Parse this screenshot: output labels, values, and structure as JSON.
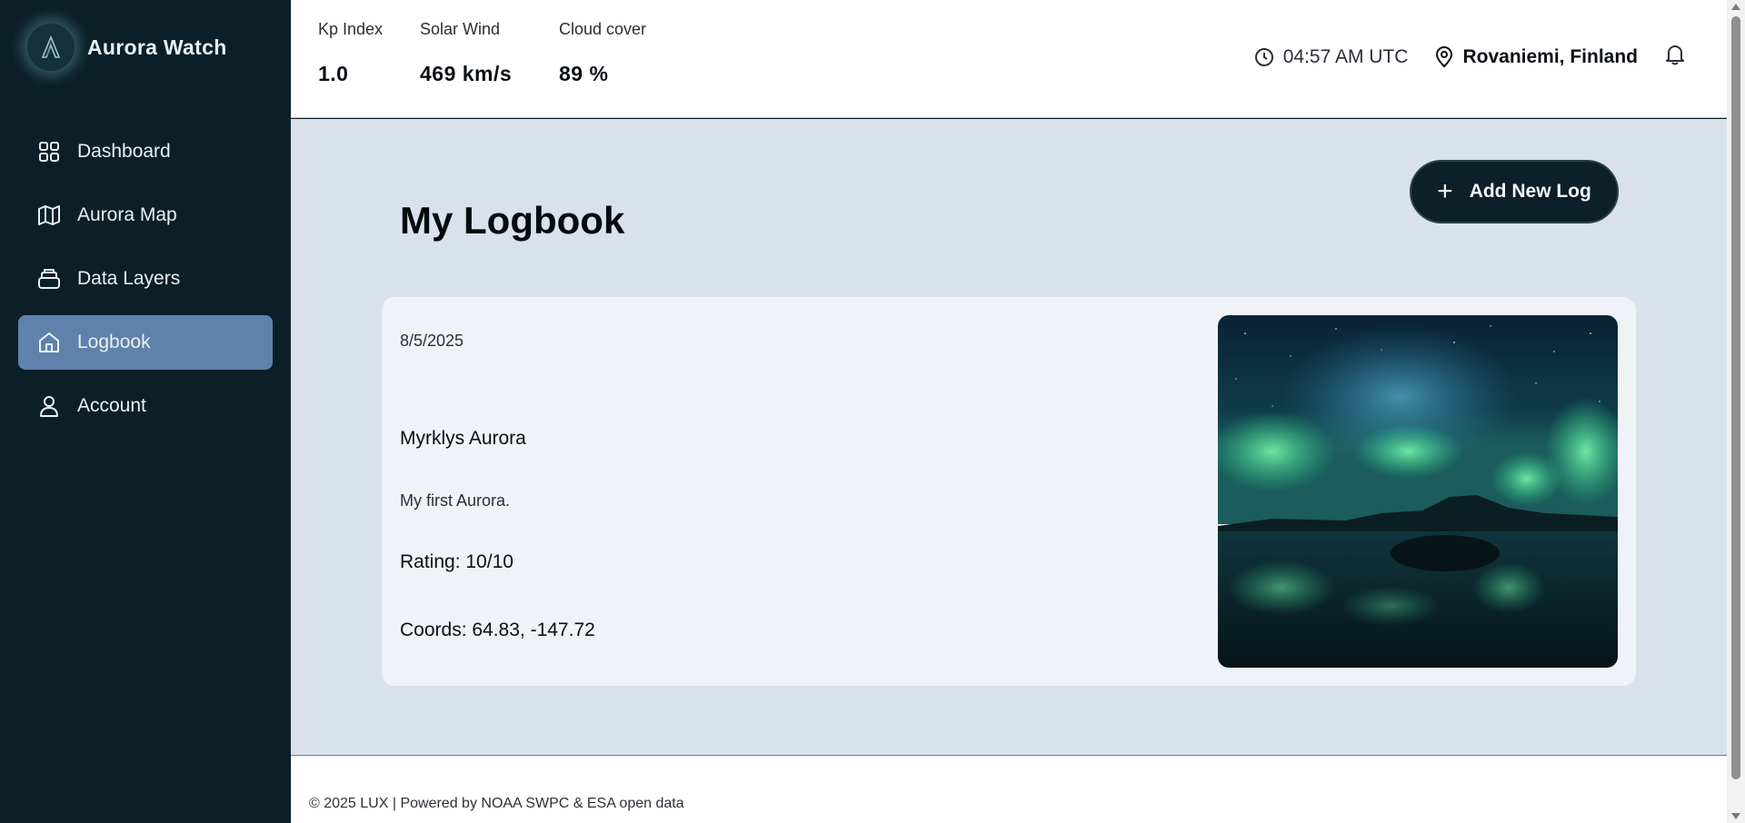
{
  "app": {
    "name": "Aurora Watch"
  },
  "sidebar": {
    "items": [
      {
        "label": "Dashboard",
        "icon": "grid-icon"
      },
      {
        "label": "Aurora Map",
        "icon": "map-icon"
      },
      {
        "label": "Data Layers",
        "icon": "layers-icon"
      },
      {
        "label": "Logbook",
        "icon": "home-icon",
        "active": true
      },
      {
        "label": "Account",
        "icon": "user-icon"
      }
    ]
  },
  "topbar": {
    "stats": [
      {
        "label": "Kp Index",
        "value": "1.0"
      },
      {
        "label": "Solar Wind",
        "value": "469 km/s"
      },
      {
        "label": "Cloud cover",
        "value": "89 %"
      }
    ],
    "time": "04:57 AM UTC",
    "location": "Rovaniemi, Finland"
  },
  "main": {
    "title": "My Logbook",
    "add_button": "Add New Log",
    "entry": {
      "date": "8/5/2025",
      "title": "Myrklys Aurora",
      "description": "My first Aurora.",
      "rating": "Rating: 10/10",
      "coords": "Coords: 64.83, -147.72"
    }
  },
  "footer": {
    "text": "© 2025 LUX | Powered by NOAA SWPC & ESA open data"
  },
  "colors": {
    "sidebar": "#0c1f29",
    "active_nav": "#5f81ab",
    "main_bg": "#d9e1ec",
    "card_bg": "#eff2f6"
  }
}
